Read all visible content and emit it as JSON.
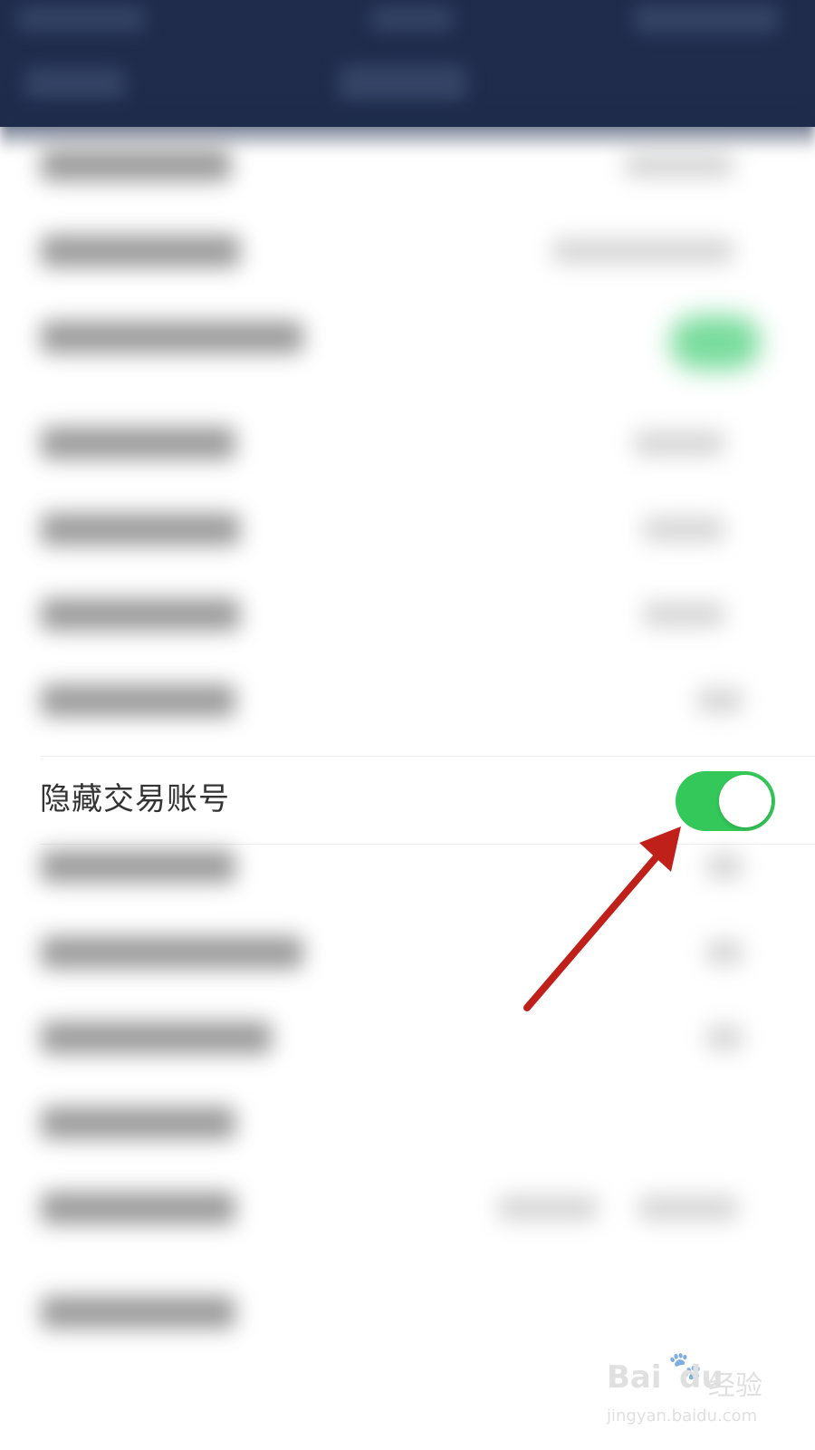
{
  "setting": {
    "label": "隐藏交易账号",
    "toggle_on": true,
    "toggle_color": "#34c759"
  },
  "annotation": {
    "arrow_color": "#c0201a",
    "arrow_target": "toggle-switch"
  },
  "watermark": {
    "logo": "Bai",
    "logo_suffix": "du",
    "brand_cn": "经验",
    "url": "jingyan.baidu.com",
    "paw_icon": "baidu-paw-icon"
  }
}
